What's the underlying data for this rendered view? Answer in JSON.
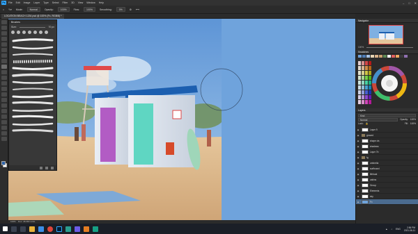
{
  "window": {
    "menu": [
      "File",
      "Edit",
      "Image",
      "Layer",
      "Type",
      "Select",
      "Filter",
      "3D",
      "View",
      "Window",
      "Help"
    ],
    "window_controls": [
      "–",
      "□",
      "✕"
    ]
  },
  "options_bar": {
    "mode_label": "Mode:",
    "mode_value": "Normal",
    "opacity_label": "Opacity:",
    "opacity_value": "100%",
    "flow_label": "Flow:",
    "flow_value": "100%",
    "smoothing_label": "Smoothing:",
    "smoothing_value": "0%"
  },
  "document_tab": {
    "title": "LOCATION BEACH 1234 psd @ 100% (Fx, RGB/8) *"
  },
  "brushes_panel": {
    "title": "Brushes",
    "size_label": "Size:",
    "size_value": "70 px"
  },
  "navigator": {
    "title": "Navigator",
    "zoom": "100%"
  },
  "swatches": {
    "title": "Swatches",
    "colors": [
      "#6ea0d8",
      "#4d7bb5",
      "#a8c4e6",
      "#e8d5b5",
      "#d9b28a",
      "#c8a070",
      "#5f8a55",
      "#ffffff",
      "#e06060",
      "#f0a860",
      "#3a3a3a",
      "#8f6fb0"
    ]
  },
  "layers_panel": {
    "title": "Layers",
    "kind_label": "Kind",
    "blend_mode": "Normal",
    "opacity_label": "Opacity:",
    "opacity_value": "100%",
    "lock_label": "Lock:",
    "fill_label": "Fill:",
    "fill_value": "100%",
    "layers": [
      {
        "name": "Layer 9",
        "type": "layer"
      },
      {
        "name": "ground",
        "type": "group"
      },
      {
        "name": "shape cls",
        "type": "layer"
      },
      {
        "name": "shadows",
        "type": "layer"
      },
      {
        "name": "Layer 7b",
        "type": "layer"
      },
      {
        "name": "fg",
        "type": "group"
      },
      {
        "name": "umbrella",
        "type": "layer"
      },
      {
        "name": "surfboard",
        "type": "layer"
      },
      {
        "name": "lifeboat",
        "type": "layer"
      },
      {
        "name": "cabins",
        "type": "layer"
      },
      {
        "name": "Group",
        "type": "layer"
      },
      {
        "name": "Elements",
        "type": "layer"
      },
      {
        "name": "sky",
        "type": "layer"
      },
      {
        "name": "Fx",
        "type": "layer",
        "selected": true
      }
    ]
  },
  "status_bar": {
    "zoom": "100%",
    "doc_info": "Doc: 48.0M/1.21G"
  },
  "taskbar": {
    "language": "ENG",
    "time": "2:56 PM",
    "date": "2021-06-11"
  }
}
